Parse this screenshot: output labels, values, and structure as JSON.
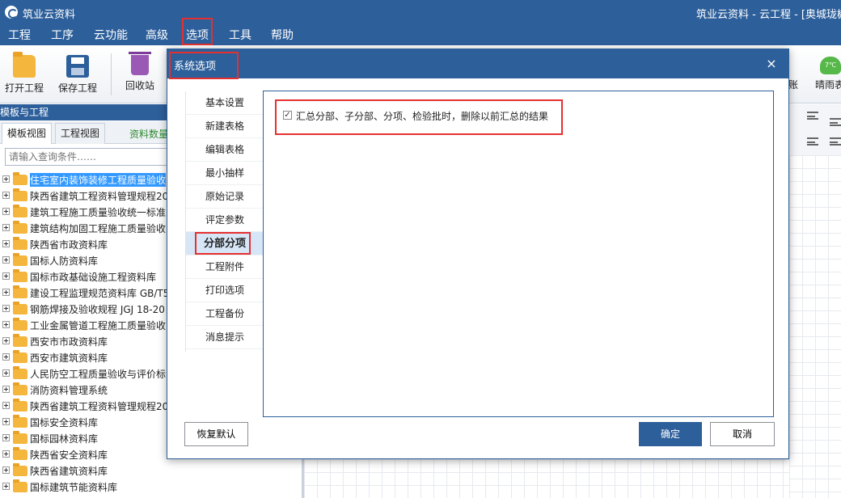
{
  "titlebar": {
    "app_title": "筑业云资料",
    "window_title": "筑业云资料 - 云工程 - [奥城珑樾"
  },
  "menu": [
    "工程",
    "工序",
    "云功能",
    "高级",
    "选项",
    "工具",
    "帮助"
  ],
  "toolbar": {
    "open_label": "打开工程",
    "save_label": "保存工程",
    "recycle_label": "回收站",
    "partial_label": "账",
    "weather_temp": "7℃",
    "weather_label": "晴雨表"
  },
  "left_panel": {
    "header": "模板与工程",
    "tabs": [
      "模板视图",
      "工程视图"
    ],
    "count_label": "资料数量",
    "search_placeholder": "请输入查询条件……",
    "tree_items": [
      "住宅室内装饰装修工程质量验收",
      "陕西省建筑工程资料管理规程20",
      "建筑工程施工质量验收统一标准",
      "建筑结构加固工程施工质量验收",
      "陕西省市政资料库",
      "国标人防资料库",
      "国标市政基础设施工程资料库",
      "建设工程监理规范资料库 GB/T5",
      "钢筋焊接及验收规程 JGJ 18-20",
      "工业金属管道工程施工质量验收",
      "西安市市政资料库",
      "西安市建筑资料库",
      "人民防空工程质量验收与评价标",
      "消防资料管理系统",
      "陕西省建筑工程资料管理规程20",
      "国标安全资料库",
      "国标园林资料库",
      "陕西省安全资料库",
      "陕西省建筑资料库",
      "国标建筑节能资料库"
    ]
  },
  "dialog": {
    "title": "系统选项",
    "close_glyph": "×",
    "nav_items": [
      "基本设置",
      "新建表格",
      "编辑表格",
      "最小抽样",
      "原始记录",
      "评定参数",
      "分部分项",
      "工程附件",
      "打印选项",
      "工程备份",
      "消息提示"
    ],
    "active_nav": "分部分项",
    "option_checked_glyph": "✓",
    "option_label": "汇总分部、子分部、分项、检验批时，删除以前汇总的结果",
    "restore_label": "恢复默认",
    "ok_label": "确定",
    "cancel_label": "取消"
  },
  "colors": {
    "primary": "#2d5f9b",
    "highlight": "#e53030",
    "selected": "#3399ff"
  }
}
